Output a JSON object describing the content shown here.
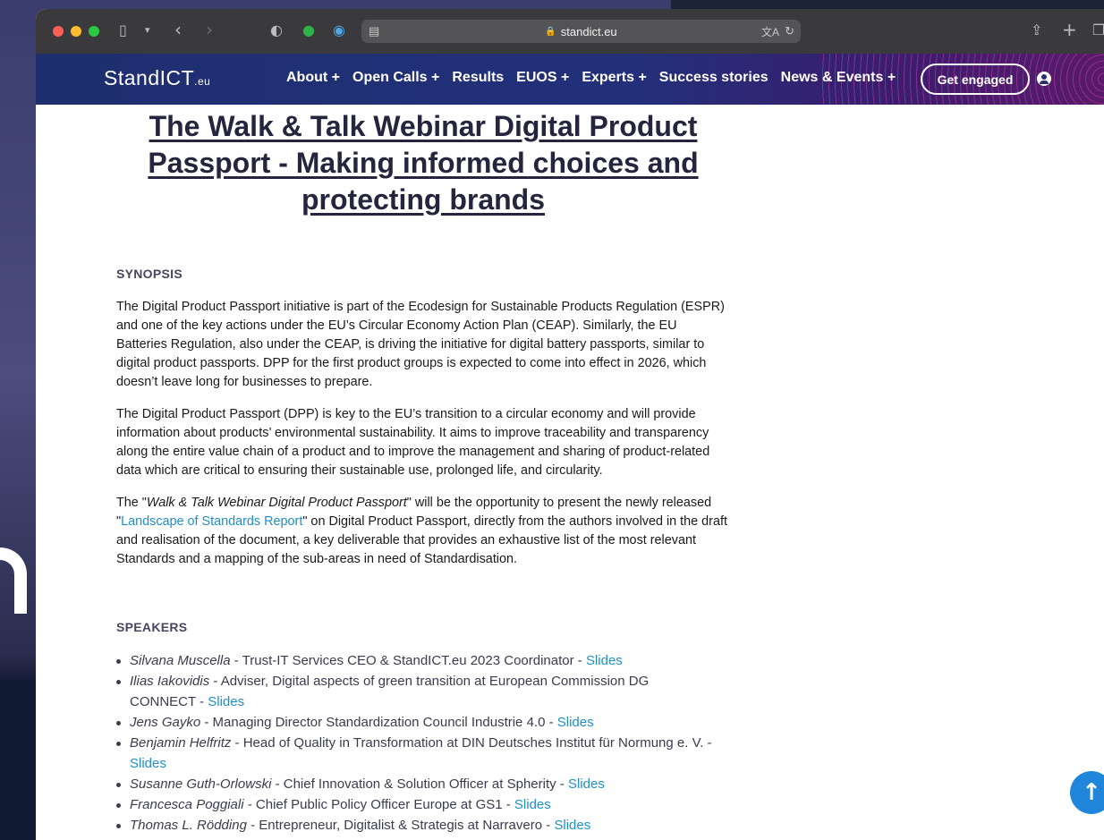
{
  "browser": {
    "url": "standict.eu"
  },
  "site": {
    "logo": "StandICT",
    "logo_suffix": ".eu",
    "nav": [
      "About +",
      "Open Calls +",
      "Results",
      "EUOS +",
      "Experts +",
      "Success stories",
      "News & Events +"
    ],
    "cta": "Get engaged"
  },
  "article": {
    "title": "The Walk & Talk Webinar Digital Product Passport - Making informed choices and protecting brands",
    "synopsis_heading": "SYNOPSIS",
    "p1": "The Digital Product Passport initiative is part of the Ecodesign for Sustainable Products Regulation (ESPR) and one of the key actions under the EU’s Circular Economy Action Plan (CEAP). Similarly, the EU Batteries Regulation, also under the CEAP, is driving the initiative for digital battery passports, similar to digital product passports. DPP for the first product groups is expected to come into effect in 2026, which doesn’t leave long for businesses to prepare.",
    "p2": "The Digital Product Passport (DPP) is key to the EU’s transition to a circular economy and will provide information about products’ environmental sustainability. It aims to improve traceability and transparency along the entire value chain of a product and to improve the management and sharing of product-related data which are critical to ensuring their sustainable use, prolonged life, and circularity.",
    "p3_a": "The \"",
    "p3_em": "Walk & Talk Webinar Digital Product Passport",
    "p3_b": "\" will be the opportunity to present the newly released \"",
    "p3_link": "Landscape of Standards Report",
    "p3_c": "\" on Digital Product Passport, directly from the authors involved in the draft and realisation of the document, a key deliverable that provides an exhaustive list of the most relevant Standards and a mapping of the sub-areas in need of Standardisation.",
    "speakers_heading": "SPEAKERS",
    "speakers": [
      {
        "name": "Silvana Muscella",
        "role": " - Trust-IT Services CEO & StandICT.eu 2023 Coordinator - ",
        "link": "Slides"
      },
      {
        "name": "Ilias Iakovidis",
        "role": " - Adviser, Digital aspects of green transition at European Commission DG CONNECT - ",
        "link": "Slides"
      },
      {
        "name": "Jens Gayko",
        "role": " - Managing Director Standardization Council Industrie 4.0 - ",
        "link": "Slides"
      },
      {
        "name": "Benjamin Helfritz",
        "role": " - Head of Quality in Transformation at DIN Deutsches Institut für Normung e. V. - ",
        "link": "Slides"
      },
      {
        "name": "Susanne Guth-Orlowski",
        "role": " - Chief Innovation & Solution Officer at Spherity - ",
        "link": "Slides"
      },
      {
        "name": "Francesca Poggiali",
        "role": " - Chief Public Policy Officer Europe at GS1 - ",
        "link": "Slides"
      },
      {
        "name": "Thomas L. Rödding",
        "role": " - Entrepreneur, Digitalist & Strategis at Narravero - ",
        "link": "Slides"
      }
    ]
  },
  "colors": {
    "link": "#1e8fc8",
    "nav_bg": "#22307a",
    "scroll_button": "#1f86dc"
  },
  "icons": [
    "sidebar-icon",
    "chevron-down-icon",
    "back-icon",
    "forward-icon",
    "shield-icon",
    "evernote-icon",
    "extension-icon",
    "reader-icon",
    "lock-icon",
    "translate-icon",
    "reload-icon",
    "share-icon",
    "new-tab-icon",
    "tabs-icon",
    "user-icon",
    "arrow-up-icon"
  ]
}
